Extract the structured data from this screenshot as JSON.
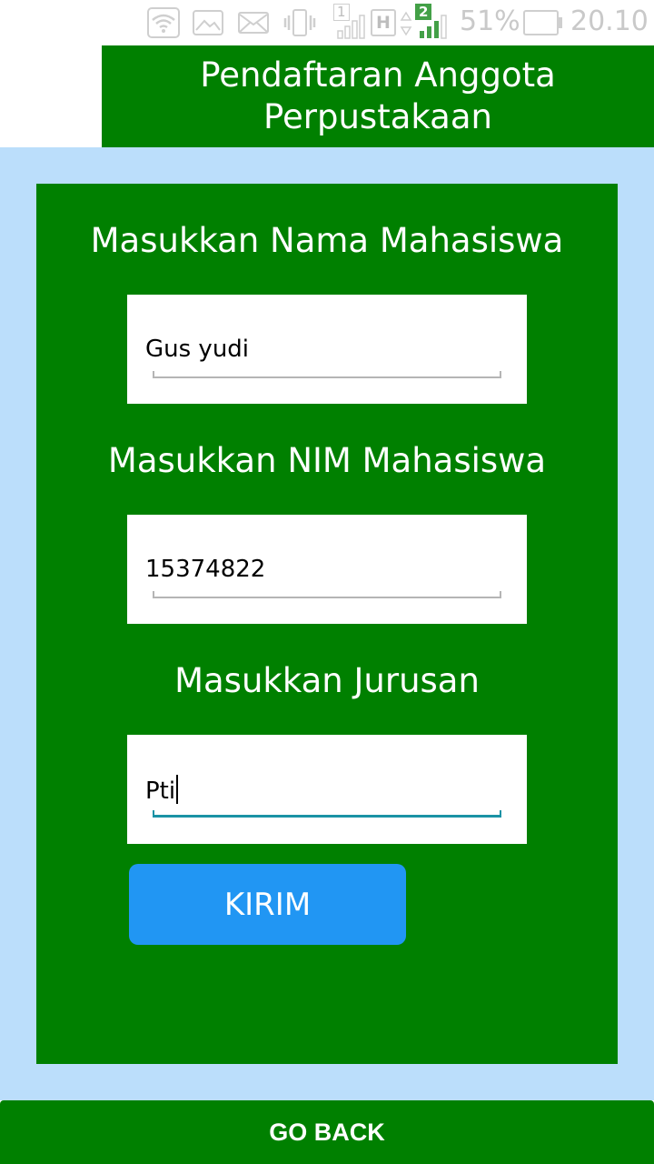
{
  "status_bar": {
    "battery_percent": "51%",
    "time": "20.10",
    "sim_slot_1": "1",
    "network_type": "H",
    "sim_slot_2": "2",
    "icons": [
      "wifi-icon",
      "gallery-notification-icon",
      "mail-notification-icon",
      "vibrate-icon",
      "signal-sim1-icon",
      "network-h-icon",
      "signal-sim2-icon",
      "battery-icon"
    ],
    "active_signal_color": "#43a047"
  },
  "header": {
    "title_line1": "Pendaftaran Anggota",
    "title_line2": "Perpustakaan"
  },
  "form": {
    "name_label": "Masukkan Nama Mahasiswa",
    "name_value": "Gus yudi",
    "nim_label": "Masukkan NIM Mahasiswa",
    "nim_value": "15374822",
    "major_label": "Masukkan Jurusan",
    "major_value": "Pti",
    "submit_label": "KIRIM"
  },
  "footer": {
    "go_back_label": "GO BACK"
  },
  "colors": {
    "primary_green": "#008000",
    "background_light_blue": "#bbdefb",
    "button_blue": "#2196f3",
    "focused_underline": "#1a92a5"
  }
}
